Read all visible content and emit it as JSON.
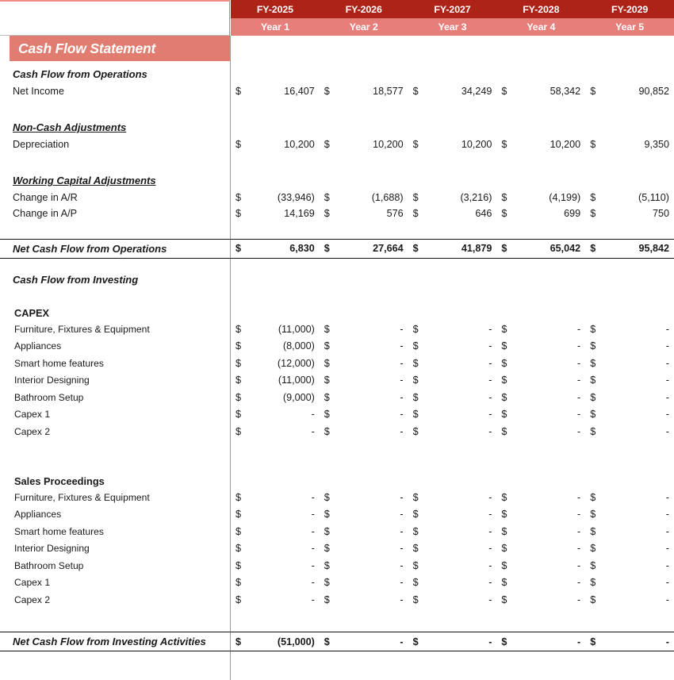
{
  "title": "Cash Flow Statement",
  "columns": [
    {
      "fy": "FY-2025",
      "year": "Year 1"
    },
    {
      "fy": "FY-2026",
      "year": "Year 2"
    },
    {
      "fy": "FY-2027",
      "year": "Year 3"
    },
    {
      "fy": "FY-2028",
      "year": "Year 4"
    },
    {
      "fy": "FY-2029",
      "year": "Year 5"
    }
  ],
  "currency_symbol": "$",
  "colors": {
    "header_dark": "#AE2318",
    "header_light": "#E67F7A",
    "title_bar": "#E07D70",
    "divider": "#9A9A9A"
  },
  "sections": {
    "operations_heading": "Cash Flow from Operations",
    "net_income": {
      "label": "Net Income",
      "values": [
        "16,407",
        "18,577",
        "34,249",
        "58,342",
        "90,852"
      ]
    },
    "noncash_heading": "Non-Cash Adjustments",
    "depreciation": {
      "label": "Depreciation",
      "values": [
        "10,200",
        "10,200",
        "10,200",
        "10,200",
        "9,350"
      ]
    },
    "working_capital_heading": "Working Capital Adjustments",
    "change_ar": {
      "label": "Change in A/R",
      "values": [
        "(33,946)",
        "(1,688)",
        "(3,216)",
        "(4,199)",
        "(5,110)"
      ]
    },
    "change_ap": {
      "label": "Change in A/P",
      "values": [
        "14,169",
        "576",
        "646",
        "699",
        "750"
      ]
    },
    "net_cash_operations": {
      "label": "Net Cash Flow from Operations",
      "values": [
        "6,830",
        "27,664",
        "41,879",
        "65,042",
        "95,842"
      ]
    },
    "investing_heading": "Cash Flow from Investing",
    "capex_heading": "CAPEX",
    "capex_rows": [
      {
        "label": "Furniture, Fixtures & Equipment",
        "values": [
          "(11,000)",
          "-",
          "-",
          "-",
          "-"
        ]
      },
      {
        "label": "Appliances",
        "values": [
          "(8,000)",
          "-",
          "-",
          "-",
          "-"
        ]
      },
      {
        "label": "Smart home features",
        "values": [
          "(12,000)",
          "-",
          "-",
          "-",
          "-"
        ]
      },
      {
        "label": "Interior Designing",
        "values": [
          "(11,000)",
          "-",
          "-",
          "-",
          "-"
        ]
      },
      {
        "label": "Bathroom Setup",
        "values": [
          "(9,000)",
          "-",
          "-",
          "-",
          "-"
        ]
      },
      {
        "label": "Capex 1",
        "values": [
          "-",
          "-",
          "-",
          "-",
          "-"
        ]
      },
      {
        "label": "Capex 2",
        "values": [
          "-",
          "-",
          "-",
          "-",
          "-"
        ]
      }
    ],
    "sales_proceedings_heading": "Sales Proceedings",
    "sales_rows": [
      {
        "label": "Furniture, Fixtures & Equipment",
        "values": [
          "-",
          "-",
          "-",
          "-",
          "-"
        ]
      },
      {
        "label": "Appliances",
        "values": [
          "-",
          "-",
          "-",
          "-",
          "-"
        ]
      },
      {
        "label": "Smart home features",
        "values": [
          "-",
          "-",
          "-",
          "-",
          "-"
        ]
      },
      {
        "label": "Interior Designing",
        "values": [
          "-",
          "-",
          "-",
          "-",
          "-"
        ]
      },
      {
        "label": "Bathroom Setup",
        "values": [
          "-",
          "-",
          "-",
          "-",
          "-"
        ]
      },
      {
        "label": "Capex 1",
        "values": [
          "-",
          "-",
          "-",
          "-",
          "-"
        ]
      },
      {
        "label": "Capex 2",
        "values": [
          "-",
          "-",
          "-",
          "-",
          "-"
        ]
      }
    ],
    "net_cash_investing": {
      "label": "Net Cash Flow from Investing Activities",
      "values": [
        "(51,000)",
        "-",
        "-",
        "-",
        "-"
      ]
    }
  }
}
